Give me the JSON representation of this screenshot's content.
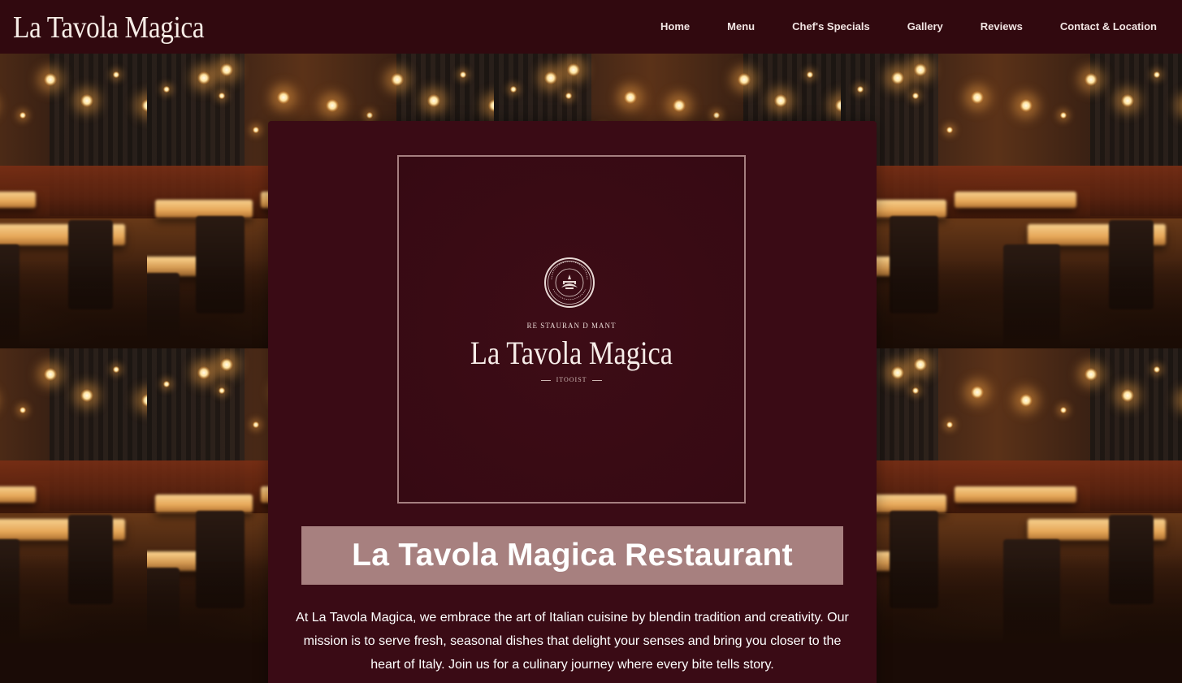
{
  "brand": {
    "name": "La Tavola Magica"
  },
  "nav": {
    "items": [
      {
        "label": "Home"
      },
      {
        "label": "Menu"
      },
      {
        "label": "Chef's Specials"
      },
      {
        "label": "Gallery"
      },
      {
        "label": "Reviews"
      },
      {
        "label": "Contact & Location"
      }
    ]
  },
  "hero": {
    "logo": {
      "sub_label": "RE STAURAN D MANT",
      "name": "La Tavola Magica",
      "bottom_label": "ITOOIST"
    },
    "title": "La Tavola Magica Restaurant",
    "intro": "At La Tavola Magica, we embrace the art of Italian cuisine by blendin tradition and creativity. Our mission is to serve fresh, seasonal dishes that delight your senses and bring you closer to the heart of Italy. Join us for a culinary journey where every bite tells story."
  },
  "colors": {
    "navbar": "#340a10",
    "card": "#3a0b15",
    "title_bar": "#a7807f",
    "text_light": "#ffffff"
  }
}
